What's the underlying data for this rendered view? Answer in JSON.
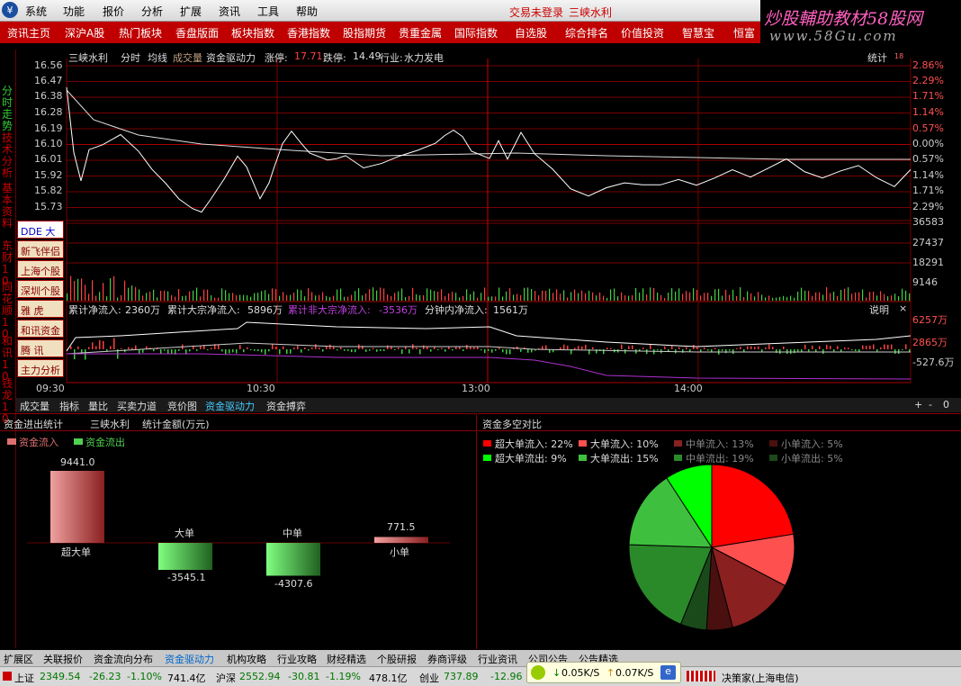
{
  "menubar": {
    "items": [
      "系统",
      "功能",
      "报价",
      "分析",
      "扩展",
      "资讯",
      "工具",
      "帮助"
    ],
    "login_status": "交易未登录",
    "stock_title": "三峡水利"
  },
  "tabbar": {
    "items": [
      "资讯主页",
      "深沪A股",
      "热门板块",
      "香盘版面",
      "板块指数",
      "香港指数",
      "股指期货",
      "贵重金属",
      "国际指数",
      "自选股",
      "综合排名",
      "价值投资",
      "智慧宝",
      "恒富"
    ]
  },
  "watermark": {
    "line1": "炒股輔助教材58股网",
    "line2": "www.58Gu.com"
  },
  "sidebar": {
    "vertical_tabs": [
      "分时走势",
      "技术分析",
      "基本资料",
      "东财10",
      "同花顺10",
      "和讯10",
      "钱龙10"
    ],
    "panel_buttons": [
      "DDE 大单",
      "新飞伴侣",
      "上海个股",
      "深圳个股",
      "雅  虎",
      "和讯资金",
      "腾  讯",
      "主力分析"
    ]
  },
  "chart": {
    "header": {
      "name": "三峡水利",
      "period": "分时",
      "ma": "均线",
      "vol": "成交量",
      "drive": "资金驱动力",
      "limit_up_label": "涨停:",
      "limit_up": "17.71",
      "limit_down_label": "跌停:",
      "limit_down": "14.49",
      "industry_label": "行业:",
      "industry": "水力发电",
      "stats": "统计",
      "stats_badge": "18"
    },
    "price_ticks": [
      "16.56",
      "16.47",
      "16.38",
      "16.28",
      "16.19",
      "16.10",
      "16.01",
      "15.92",
      "15.82",
      "15.73"
    ],
    "pct_ticks": [
      "2.86%",
      "2.29%",
      "1.71%",
      "1.14%",
      "0.57%",
      "0.00%",
      "0.57%",
      "1.14%",
      "1.71%",
      "2.29%"
    ],
    "vol_ticks": [
      "36583",
      "27437",
      "18291",
      "9146"
    ],
    "flow_header": {
      "cum_flow_label": "累计净流入:",
      "cum_flow": "2360万",
      "cum_big_label": "累计大宗净流入:",
      "cum_big": "5896万",
      "cum_nonbig_label": "累计非大宗净流入:",
      "cum_nonbig": "-3536万",
      "min_flow_label": "分钟内净流入:",
      "min_flow": "1561万",
      "explain": "说明",
      "close": "×"
    },
    "flow_ticks": [
      "6257万",
      "2865万",
      "-527.6万"
    ],
    "time_ticks": [
      "09:30",
      "10:30",
      "13:00",
      "14:00"
    ]
  },
  "bottom_tabs": {
    "items": [
      "成交量",
      "指标",
      "量比",
      "买卖力道",
      "竞价图",
      "资金驱动力",
      "资金搏弈"
    ],
    "buttons": [
      "+",
      "-",
      "0"
    ]
  },
  "capital_panel": {
    "title": "资金进出统计",
    "stock": "三峡水利",
    "unit_label": "统计金额(万元)",
    "legend_in": "资金流入",
    "legend_out": "资金流出",
    "bars": [
      {
        "label": "超大单",
        "value": "9441.0",
        "num": 9441.0
      },
      {
        "label": "大单",
        "value": "-3545.1",
        "num": -3545.1
      },
      {
        "label": "中单",
        "value": "-4307.6",
        "num": -4307.6
      },
      {
        "label": "小单",
        "value": "771.5",
        "num": 771.5
      }
    ]
  },
  "pie_panel": {
    "title": "资金多空对比",
    "legend": [
      {
        "label": "超大单流入:",
        "value": "22%",
        "color": "#ff0000"
      },
      {
        "label": "大单流入:",
        "value": "10%",
        "color": "#ff5050"
      },
      {
        "label": "中单流入:",
        "value": "13%",
        "color": "#8a2020"
      },
      {
        "label": "小单流入:",
        "value": "5%",
        "color": "#4a1010"
      },
      {
        "label": "超大单流出:",
        "value": "9%",
        "color": "#00ff00"
      },
      {
        "label": "大单流出:",
        "value": "15%",
        "color": "#3ec03e"
      },
      {
        "label": "中单流出:",
        "value": "19%",
        "color": "#2a8a2a"
      },
      {
        "label": "小单流出:",
        "value": "5%",
        "color": "#1a4a1a"
      }
    ],
    "slices": [
      22,
      10,
      13,
      5,
      5,
      19,
      15,
      9
    ],
    "slice_colors": [
      "#ff0000",
      "#ff5050",
      "#8a2020",
      "#4a1010",
      "#1a4a1a",
      "#2a8a2a",
      "#3ec03e",
      "#00ff00"
    ]
  },
  "footer_tabs": {
    "items": [
      "扩展区",
      "关联报价",
      "资金流向分布",
      "资金驱动力",
      "机构攻略",
      "行业攻略",
      "财经精选",
      "个股研报",
      "券商评级",
      "行业资讯",
      "公司公告",
      "公告精选"
    ]
  },
  "statusbar": {
    "sh_label": "上证",
    "sh_val": "2349.54",
    "sh_chg": "-26.23",
    "sh_pct": "-1.10%",
    "sh_amt": "741.4亿",
    "sz_label": "沪深",
    "sz_val": "2552.94",
    "sz_chg": "-30.81",
    "sz_pct": "-1.19%",
    "sz_amt": "478.1亿",
    "cy_label": "创业",
    "cy_val": "737.89",
    "cy_chg": "-12.96",
    "down_speed": "0.05K/S",
    "up_speed": "0.07K/S",
    "vendor": "决策家(上海电信)"
  }
}
